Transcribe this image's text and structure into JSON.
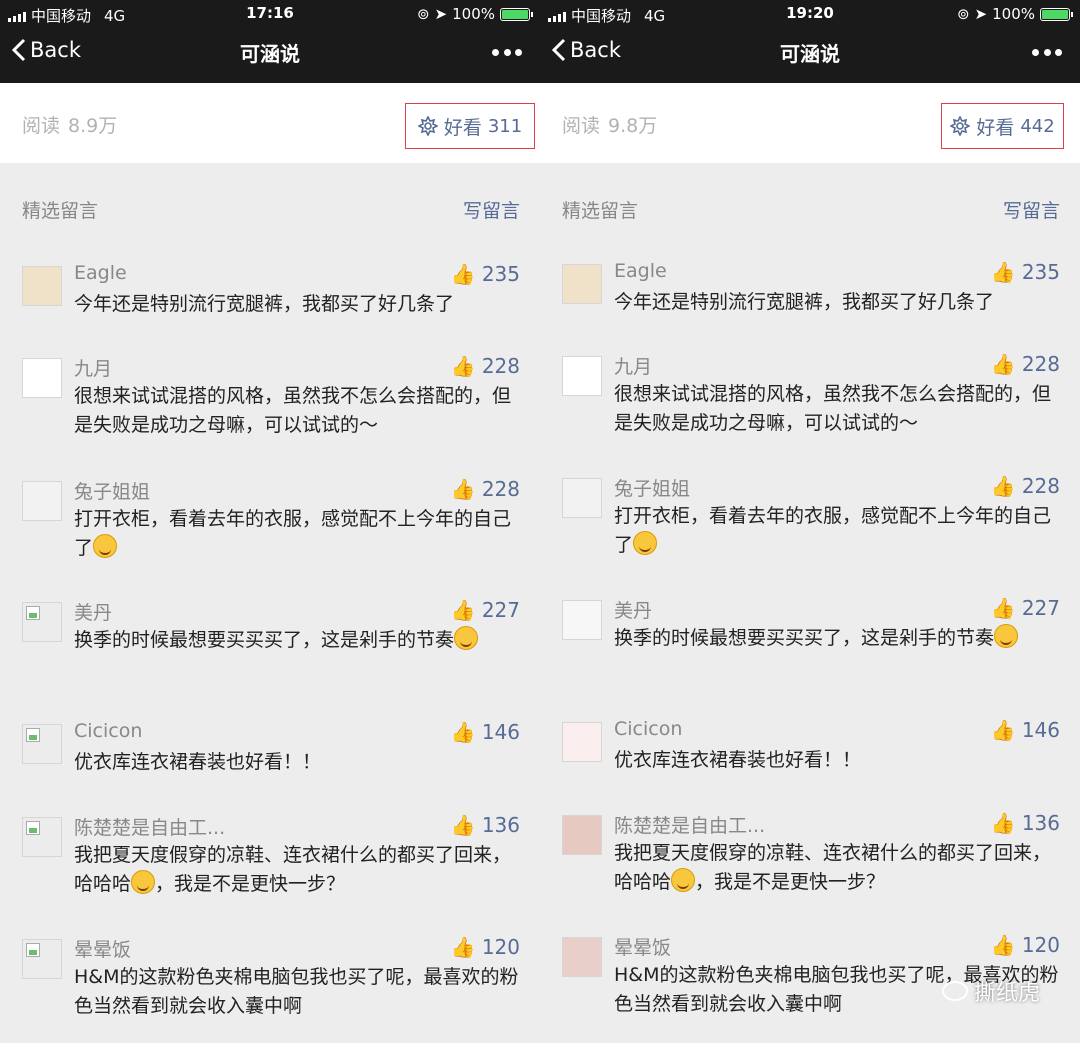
{
  "left": {
    "status": {
      "carrier": "中国移动",
      "network": "4G",
      "time": "17:16",
      "battery": "100%"
    },
    "nav": {
      "back_label": "Back",
      "title": "可涵说"
    },
    "read": {
      "label": "阅读",
      "count": "8.9万"
    },
    "haokan": {
      "label": "好看",
      "count": "311"
    },
    "comments_header": {
      "label": "精选留言",
      "write_label": "写留言"
    },
    "comments": [
      {
        "name": "Eagle",
        "likes": "235",
        "text": "今年还是特别流行宽腿裤，我都买了好几条了",
        "emoji": false,
        "avatar": "drawn"
      },
      {
        "name": "九月",
        "likes": "228",
        "text": "很想来试试混搭的风格，虽然我不怎么会搭配的，但是失败是成功之母嘛，可以试试的～",
        "emoji": false,
        "avatar": "drawn"
      },
      {
        "name": "兔子姐姐",
        "likes": "228",
        "text": "打开衣柜，看着去年的衣服，感觉配不上今年的自己了",
        "emoji": true,
        "avatar": "drawn"
      },
      {
        "name": "美丹",
        "likes": "227",
        "text": "换季的时候最想要买买买了，这是剁手的节奏",
        "emoji": true,
        "avatar": "broken"
      },
      {
        "name": "Cicicon",
        "likes": "146",
        "text": "优衣库连衣裙春装也好看！！",
        "emoji": false,
        "avatar": "broken"
      },
      {
        "name": "陈楚楚是自由工...",
        "likes": "136",
        "text": "我把夏天度假穿的凉鞋、连衣裙什么的都买了回来，哈哈哈",
        "text2": "，我是不是更快一步？",
        "emoji": true,
        "avatar": "broken"
      },
      {
        "name": "晕晕饭",
        "likes": "120",
        "text": "H&M的这款粉色夹棉电脑包我也买了呢，最喜欢的粉色当然看到就会收入囊中啊",
        "emoji": false,
        "avatar": "broken"
      }
    ]
  },
  "right": {
    "status": {
      "carrier": "中国移动",
      "network": "4G",
      "time": "19:20",
      "battery": "100%"
    },
    "nav": {
      "back_label": "Back",
      "title": "可涵说"
    },
    "read": {
      "label": "阅读",
      "count": "9.8万"
    },
    "haokan": {
      "label": "好看",
      "count": "442"
    },
    "comments_header": {
      "label": "精选留言",
      "write_label": "写留言"
    },
    "comments": [
      {
        "name": "Eagle",
        "likes": "235",
        "text": "今年还是特别流行宽腿裤，我都买了好几条了",
        "emoji": false,
        "avatar": "drawn"
      },
      {
        "name": "九月",
        "likes": "228",
        "text": "很想来试试混搭的风格，虽然我不怎么会搭配的，但是失败是成功之母嘛，可以试试的～",
        "emoji": false,
        "avatar": "drawn"
      },
      {
        "name": "兔子姐姐",
        "likes": "228",
        "text": "打开衣柜，看着去年的衣服，感觉配不上今年的自己了",
        "emoji": true,
        "avatar": "drawn"
      },
      {
        "name": "美丹",
        "likes": "227",
        "text": "换季的时候最想要买买买了，这是剁手的节奏",
        "emoji": true,
        "avatar": "drawn"
      },
      {
        "name": "Cicicon",
        "likes": "146",
        "text": "优衣库连衣裙春装也好看！！",
        "emoji": false,
        "avatar": "drawn"
      },
      {
        "name": "陈楚楚是自由工...",
        "likes": "136",
        "text": "我把夏天度假穿的凉鞋、连衣裙什么的都买了回来，哈哈哈",
        "text2": "，我是不是更快一步？",
        "emoji": true,
        "avatar": "drawn"
      },
      {
        "name": "晕晕饭",
        "likes": "120",
        "text": "H&M的这款粉色夹棉电脑包我也买了呢，最喜欢的粉色当然看到就会收入囊中啊",
        "emoji": false,
        "avatar": "drawn"
      }
    ],
    "watermark": "撕纸虎"
  },
  "colors": {
    "link": "#576b95",
    "highlight_box": "#d8404a",
    "battery": "#4cd964"
  }
}
